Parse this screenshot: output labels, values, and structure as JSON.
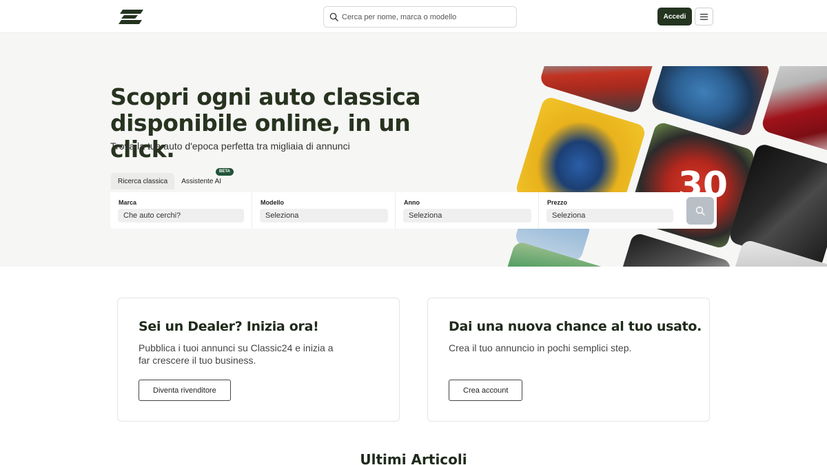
{
  "header": {
    "search_placeholder": "Cerca per nome, marca o modello",
    "login_label": "Accedi"
  },
  "hero": {
    "title": "Scopri ogni auto classica disponibile online, in un click.",
    "subtitle": "Trova la tua auto d'epoca perfetta tra migliaia di annunci"
  },
  "tabs": {
    "classic": "Ricerca classica",
    "ai": "Assistente AI",
    "ai_badge": "BETA"
  },
  "filters": {
    "brand_label": "Marca",
    "brand_value": "Che auto cerchi?",
    "model_label": "Modello",
    "model_value": "Seleziona",
    "year_label": "Anno",
    "year_value": "Seleziona",
    "price_label": "Prezzo",
    "price_value": "Seleziona"
  },
  "collage": {
    "race_number": "30"
  },
  "cards": {
    "dealer_title": "Sei un Dealer? Inizia ora!",
    "dealer_line1": "Pubblica i tuoi annunci su Classic24 e inizia a",
    "dealer_line2": "far crescere il tuo business.",
    "dealer_button": "Diventa rivenditore",
    "user_title": "Dai una nuova chance al tuo usato.",
    "user_text": "Crea il tuo annuncio in pochi semplici step.",
    "user_button": "Crea account"
  },
  "section": {
    "articles_title": "Ultimi Articoli"
  },
  "colors": {
    "brand_dark": "#23341f",
    "beta_badge": "#23543a",
    "hero_bg": "#f6f6f5"
  }
}
